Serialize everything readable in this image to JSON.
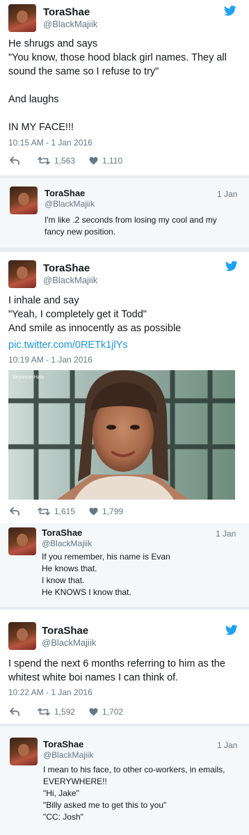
{
  "tweets": [
    {
      "name": "ToraShae",
      "handle": "@BlackMajiik",
      "text": "He shrugs and says\n\"You know, those hood black girl names. They all sound the same so I refuse to try\"\n\nAnd laughs\n\nIN MY FACE!!!",
      "timestamp": "10:15 AM - 1 Jan 2016",
      "retweets": "1,563",
      "likes": "1,110"
    },
    {
      "name": "ToraShae",
      "handle": "@BlackMajiik",
      "text": "I inhale and say\n\"Yeah, I completely get it Todd\"\nAnd smile as innocently as as possible",
      "link": "pic.twitter.com/0RETk1jlYs",
      "timestamp": "10:19 AM - 1 Jan 2016",
      "image_watermark": "BeyoncésHalo",
      "retweets": "1,615",
      "likes": "1,799"
    },
    {
      "name": "ToraShae",
      "handle": "@BlackMajiik",
      "text": "I spend the next 6 months referring to him as the whitest white boi names I can think of.",
      "timestamp": "10:22 AM - 1 Jan 2016",
      "retweets": "1,592",
      "likes": "1,702"
    }
  ],
  "replies": [
    {
      "name": "ToraShae",
      "handle": "@BlackMajiik",
      "date": "1 Jan",
      "text": "I'm like .2 seconds from losing my cool and my fancy new position."
    },
    {
      "name": "ToraShae",
      "handle": "@BlackMajiik",
      "date": "1 Jan",
      "text": "If you remember,  his name is Evan\nHe knows that.\nI know that.\nHe KNOWS I know that."
    },
    {
      "name": "ToraShae",
      "handle": "@BlackMajiik",
      "date": "1 Jan",
      "text": "I mean to his face, to other co-workers,  in emails, EVERYWHERE!!\n\"Hi, Jake\"\n\"Billy asked me to get this to you\"\n\"CC: Josh\""
    }
  ],
  "colors": {
    "twitter_blue": "#1da1f2",
    "link_blue": "#1b95e0",
    "secondary_text": "#657786"
  },
  "icons": [
    "reply-icon",
    "retweet-icon",
    "like-icon",
    "twitter-bird-icon"
  ]
}
